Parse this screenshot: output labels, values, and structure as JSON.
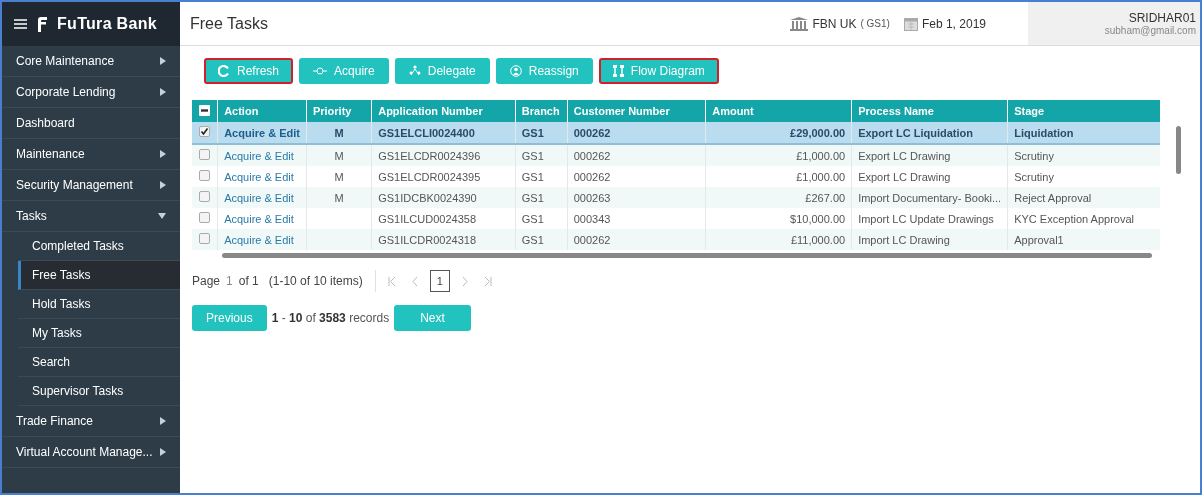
{
  "app": {
    "brand": "FuTura Bank"
  },
  "page": {
    "title": "Free Tasks"
  },
  "header": {
    "branch": "FBN UK",
    "branch_code": "( GS1)",
    "date": "Feb 1, 2019",
    "user": "SRIDHAR01",
    "email": "subham@gmail.com"
  },
  "sidebar": {
    "items": [
      {
        "label": "Core Maintenance",
        "expanded": false
      },
      {
        "label": "Corporate Lending",
        "expanded": false
      },
      {
        "label": "Dashboard"
      },
      {
        "label": "Maintenance",
        "expanded": false
      },
      {
        "label": "Security Management",
        "expanded": false
      },
      {
        "label": "Tasks",
        "expanded": true,
        "children": [
          {
            "label": "Completed Tasks",
            "selected": false
          },
          {
            "label": "Free Tasks",
            "selected": true
          },
          {
            "label": "Hold Tasks",
            "selected": false
          },
          {
            "label": "My Tasks",
            "selected": false
          },
          {
            "label": "Search",
            "selected": false
          },
          {
            "label": "Supervisor Tasks",
            "selected": false
          }
        ]
      },
      {
        "label": "Trade Finance",
        "expanded": false
      },
      {
        "label": "Virtual Account Manage...",
        "expanded": false
      }
    ]
  },
  "toolbar": [
    {
      "kind": "refresh",
      "label": "Refresh",
      "highlighted": true
    },
    {
      "kind": "acquire",
      "label": "Acquire",
      "highlighted": false
    },
    {
      "kind": "delegate",
      "label": "Delegate",
      "highlighted": false
    },
    {
      "kind": "reassign",
      "label": "Reassign",
      "highlighted": false
    },
    {
      "kind": "flow",
      "label": "Flow Diagram",
      "highlighted": true
    }
  ],
  "table": {
    "select_all_partial": true,
    "columns": [
      "Action",
      "Priority",
      "Application Number",
      "Branch",
      "Customer Number",
      "Amount",
      "Process Name",
      "Stage"
    ],
    "rows": [
      {
        "selected": true,
        "cells": [
          "Acquire & Edit",
          "M",
          "GS1ELCLI0024400",
          "GS1",
          "000262",
          "£29,000.00",
          "Export LC Liquidation",
          "Liquidation"
        ]
      },
      {
        "selected": false,
        "cells": [
          "Acquire & Edit",
          "M",
          "GS1ELCDR0024396",
          "GS1",
          "000262",
          "£1,000.00",
          "Export LC Drawing",
          "Scrutiny"
        ]
      },
      {
        "selected": false,
        "cells": [
          "Acquire & Edit",
          "M",
          "GS1ELCDR0024395",
          "GS1",
          "000262",
          "£1,000.00",
          "Export LC Drawing",
          "Scrutiny"
        ]
      },
      {
        "selected": false,
        "cells": [
          "Acquire & Edit",
          "M",
          "GS1IDCBK0024390",
          "GS1",
          "000263",
          "£267.00",
          "Import Documentary- Booki...",
          "Reject Approval"
        ]
      },
      {
        "selected": false,
        "cells": [
          "Acquire & Edit",
          "",
          "GS1ILCUD0024358",
          "GS1",
          "000343",
          "$10,000.00",
          "Import LC Update Drawings",
          "KYC Exception Approval"
        ]
      },
      {
        "selected": false,
        "cells": [
          "Acquire & Edit",
          "",
          "GS1ILCDR0024318",
          "GS1",
          "000262",
          "£11,000.00",
          "Import LC Drawing",
          "Approval1"
        ]
      }
    ]
  },
  "pager": {
    "page_label": "Page",
    "page": "1",
    "of_pages": "of 1",
    "items": "(1-10 of 10 items)",
    "current": "1"
  },
  "records": {
    "previous": "Previous",
    "summary": "**1** - **10** of **3583** records",
    "next": "Next"
  }
}
